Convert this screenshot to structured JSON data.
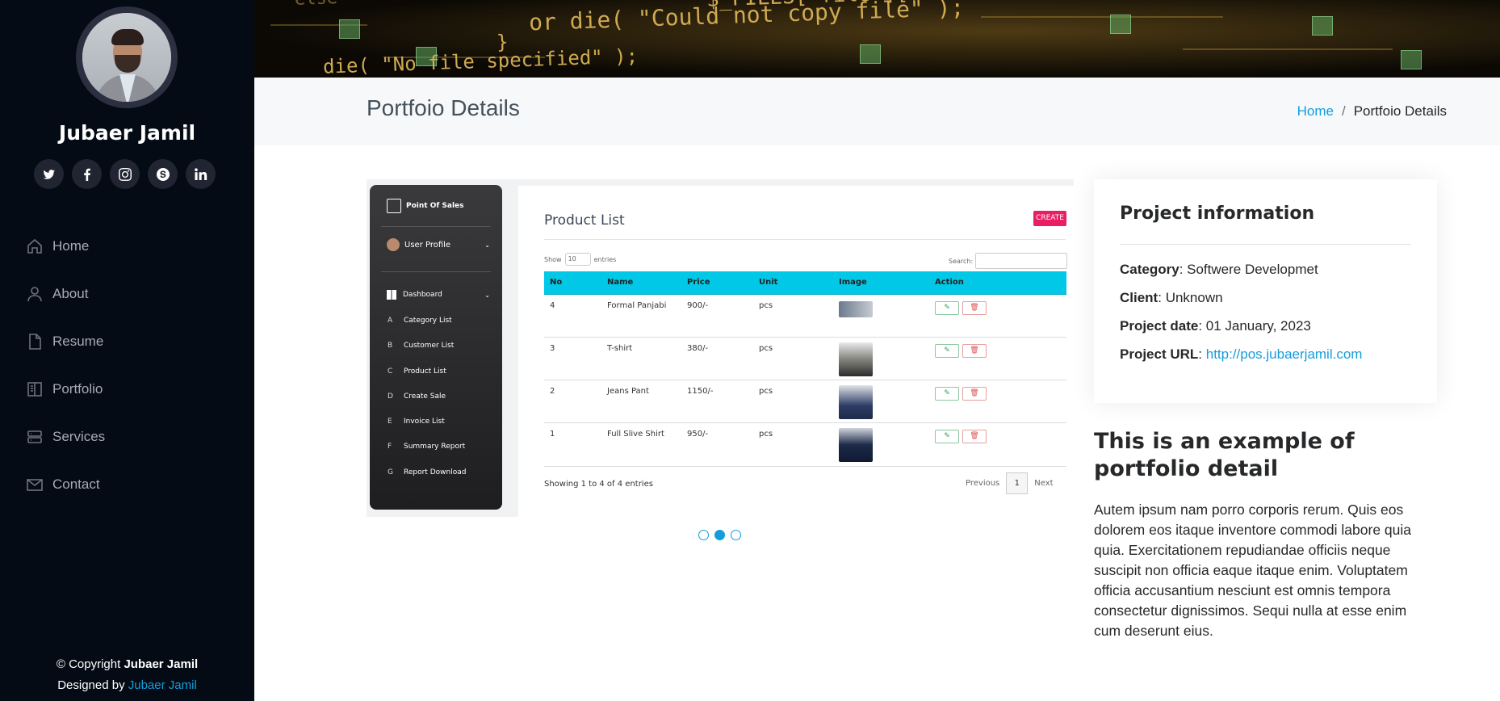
{
  "sidebar": {
    "name": "Jubaer Jamil",
    "socials": [
      {
        "icon": "twitter-icon"
      },
      {
        "icon": "facebook-icon"
      },
      {
        "icon": "instagram-icon"
      },
      {
        "icon": "skype-icon"
      },
      {
        "icon": "linkedin-icon"
      }
    ],
    "nav": [
      {
        "label": "Home",
        "icon": "home-icon"
      },
      {
        "label": "About",
        "icon": "person-icon"
      },
      {
        "label": "Resume",
        "icon": "file-icon"
      },
      {
        "label": "Portfolio",
        "icon": "book-icon"
      },
      {
        "label": "Services",
        "icon": "server-icon"
      },
      {
        "label": "Contact",
        "icon": "envelope-icon"
      }
    ],
    "footer": {
      "copyright_prefix": "© Copyright ",
      "copyright_name": "Jubaer Jamil",
      "designed_prefix": "Designed by ",
      "designed_link": "Jubaer Jamil"
    }
  },
  "hero": {
    "code_lines": [
      "or die( \"Could not copy file\" );",
      "die( \"No file specified\" );",
      "else",
      "}",
      "$_FILES['file']['name'] }"
    ]
  },
  "breadcrumbs": {
    "title": "Portfoio Details",
    "home": "Home",
    "separator": "/",
    "current": "Portfoio Details"
  },
  "slide": {
    "app_name": "Point Of Sales",
    "user_profile": "User Profile",
    "dashboard": "Dashboard",
    "menu": [
      {
        "letter": "A",
        "label": "Category List"
      },
      {
        "letter": "B",
        "label": "Customer List"
      },
      {
        "letter": "C",
        "label": "Product List"
      },
      {
        "letter": "D",
        "label": "Create Sale"
      },
      {
        "letter": "E",
        "label": "Invoice List"
      },
      {
        "letter": "F",
        "label": "Summary Report"
      },
      {
        "letter": "G",
        "label": "Report Download"
      }
    ],
    "list_title": "Product List",
    "create_label": "CREATE",
    "show_label": "Show",
    "show_value": "10",
    "entries_label": "entries",
    "search_label": "Search:",
    "columns": [
      "No",
      "Name",
      "Price",
      "Unit",
      "Image",
      "Action"
    ],
    "rows": [
      {
        "no": "4",
        "name": "Formal Panjabi",
        "price": "900/-",
        "unit": "pcs"
      },
      {
        "no": "3",
        "name": "T-shirt",
        "price": "380/-",
        "unit": "pcs"
      },
      {
        "no": "2",
        "name": "Jeans Pant",
        "price": "1150/-",
        "unit": "pcs"
      },
      {
        "no": "1",
        "name": "Full Slive Shirt",
        "price": "950/-",
        "unit": "pcs"
      }
    ],
    "showing": "Showing 1 to 4 of 4 entries",
    "prev": "Previous",
    "page": "1",
    "next": "Next"
  },
  "slider": {
    "count": 3,
    "active_index": 1
  },
  "project": {
    "heading": "Project information",
    "category_label": "Category",
    "category": "Softwere Developmet",
    "client_label": "Client",
    "client": "Unknown",
    "date_label": "Project date",
    "date": "01 January, 2023",
    "url_label": "Project URL",
    "url": "http://pos.jubaerjamil.com"
  },
  "description": {
    "heading": "This is an example of portfolio detail",
    "text": "Autem ipsum nam porro corporis rerum. Quis eos dolorem eos itaque inventore commodi labore quia quia. Exercitationem repudiandae officiis neque suscipit non officia eaque itaque enim. Voluptatem officia accusantium nesciunt est omnis tempora consectetur dignissimos. Sequi nulla at esse enim cum deserunt eius."
  },
  "colors": {
    "accent": "#149ddd",
    "sidebar": "#040b14",
    "table_header": "#00c8e6",
    "create": "#e91e63"
  }
}
